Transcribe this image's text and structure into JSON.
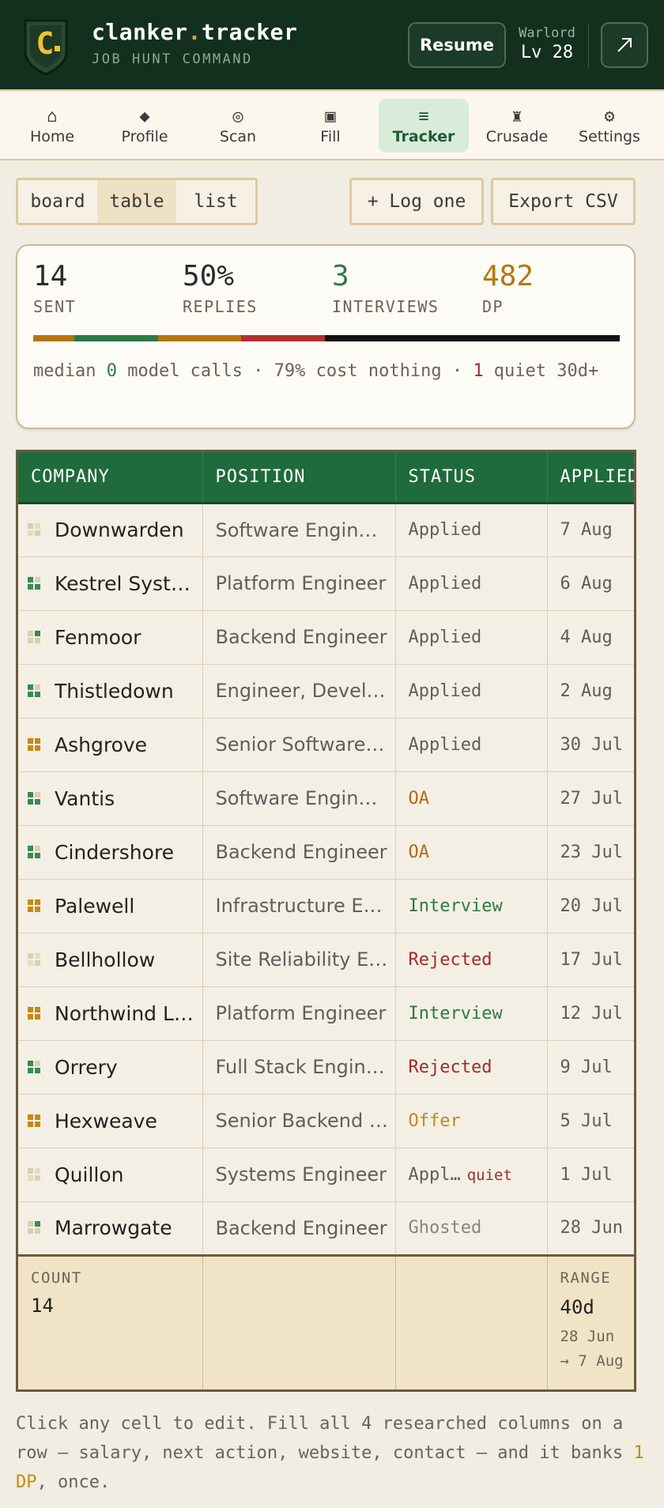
{
  "header": {
    "brand_name": "clanker",
    "brand_dot": ".",
    "brand_suffix": "tracker",
    "brand_subtitle": "JOB HUNT COMMAND",
    "logo_letter": "C",
    "resume_label": "Resume",
    "rank_title": "Warlord",
    "rank_level": "Lv 28"
  },
  "nav": {
    "items": [
      {
        "label": "Home",
        "icon": "home-icon",
        "glyph": "⌂"
      },
      {
        "label": "Profile",
        "icon": "diamond-icon",
        "glyph": "◆"
      },
      {
        "label": "Scan",
        "icon": "radar-icon",
        "glyph": "◎"
      },
      {
        "label": "Fill",
        "icon": "form-icon",
        "glyph": "▣"
      },
      {
        "label": "Tracker",
        "icon": "list-icon",
        "glyph": "≡",
        "active": true
      },
      {
        "label": "Crusade",
        "icon": "rook-icon",
        "glyph": "♜"
      },
      {
        "label": "Settings",
        "icon": "gear-icon",
        "glyph": "⚙"
      }
    ]
  },
  "toolbar": {
    "views": [
      "board",
      "table",
      "list"
    ],
    "active_view": "table",
    "log_label": "+ Log one",
    "export_label": "Export CSV"
  },
  "stats": {
    "sent_value": "14",
    "sent_label": "SENT",
    "replies_value": "50%",
    "replies_label": "REPLIES",
    "interviews_value": "3",
    "interviews_label": "INTERVIEWS",
    "dp_value": "482",
    "dp_label": "DP",
    "note_prefix": "median ",
    "note_calls": "0",
    "note_mid": " model calls · 79% cost nothing · ",
    "note_quiet": "1",
    "note_suffix": " quiet 30d+",
    "progress": [
      {
        "share": 0.07,
        "color": "#b5760f"
      },
      {
        "share": 0.143,
        "color": "#2c7a45"
      },
      {
        "share": 0.143,
        "color": "#b5760f"
      },
      {
        "share": 0.143,
        "color": "#b03030"
      },
      {
        "share": 0.504,
        "color": "#111111"
      }
    ]
  },
  "table": {
    "columns": [
      "COMPANY",
      "POSITION",
      "STATUS",
      "APPLIED"
    ],
    "rows": [
      {
        "company": "Downwarden",
        "position": "Software Engineer",
        "status": "Applied",
        "status_class": "st-applied",
        "applied": "7 Aug",
        "mark": "faded"
      },
      {
        "company": "Kestrel Systems",
        "position": "Platform Engineer",
        "status": "Applied",
        "status_class": "st-applied",
        "applied": "6 Aug",
        "mark": "green"
      },
      {
        "company": "Fenmoor",
        "position": "Backend Engineer",
        "status": "Applied",
        "status_class": "st-applied",
        "applied": "4 Aug",
        "mark": "green-faded"
      },
      {
        "company": "Thistledown",
        "position": "Engineer, Developer",
        "status": "Applied",
        "status_class": "st-applied",
        "applied": "2 Aug",
        "mark": "green"
      },
      {
        "company": "Ashgrove",
        "position": "Senior Software Engineer",
        "status": "Applied",
        "status_class": "st-applied",
        "applied": "30 Jul",
        "mark": "amber"
      },
      {
        "company": "Vantis",
        "position": "Software Engineer",
        "status": "OA",
        "status_class": "st-oa",
        "applied": "27 Jul",
        "mark": "green"
      },
      {
        "company": "Cindershore",
        "position": "Backend Engineer",
        "status": "OA",
        "status_class": "st-oa",
        "applied": "23 Jul",
        "mark": "green"
      },
      {
        "company": "Palewell",
        "position": "Infrastructure Engineer",
        "status": "Interview",
        "status_class": "st-interview",
        "applied": "20 Jul",
        "mark": "amber"
      },
      {
        "company": "Bellhollow",
        "position": "Site Reliability Engineer",
        "status": "Rejected",
        "status_class": "st-rejected",
        "applied": "17 Jul",
        "mark": "faded"
      },
      {
        "company": "Northwind Labs",
        "position": "Platform Engineer",
        "status": "Interview",
        "status_class": "st-interview",
        "applied": "12 Jul",
        "mark": "amber"
      },
      {
        "company": "Orrery",
        "position": "Full Stack Engineer",
        "status": "Rejected",
        "status_class": "st-rejected",
        "applied": "9 Jul",
        "mark": "green"
      },
      {
        "company": "Hexweave",
        "position": "Senior Backend Engineer",
        "status": "Offer",
        "status_class": "st-offer",
        "applied": "5 Jul",
        "mark": "amber"
      },
      {
        "company": "Quillon",
        "position": "Systems Engineer",
        "status": "Appl…",
        "status_class": "st-applied",
        "applied": "1 Jul",
        "mark": "faded",
        "quiet": "quiet"
      },
      {
        "company": "Marrowgate",
        "position": "Backend Engineer",
        "status": "Ghosted",
        "status_class": "st-ghosted",
        "applied": "28 Jun",
        "mark": "green-faded"
      }
    ],
    "footer": {
      "count_label": "COUNT",
      "count_value": "14",
      "range_label": "RANGE",
      "range_value": "40d",
      "range_from": "28 Jun",
      "range_to": "→ 7 Aug"
    }
  },
  "footer_note": {
    "prefix": "Click any cell to edit. Fill all 4 researched columns on a row — salary, next action, website, contact — and it banks ",
    "dp": "1 DP",
    "suffix": ", once."
  },
  "colors": {
    "header_bg": "#13301f",
    "accent_green": "#1f6b3c",
    "accent_amber": "#c48a18",
    "danger": "#a02c2c"
  }
}
